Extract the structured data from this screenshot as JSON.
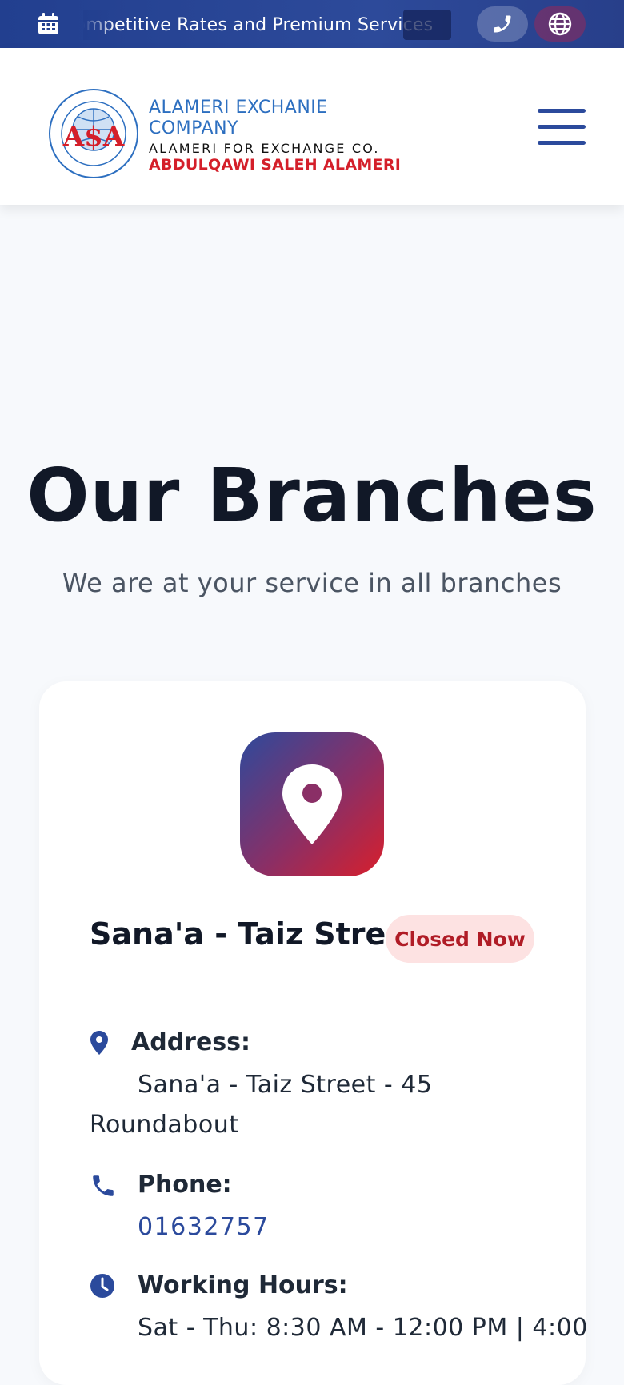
{
  "topbar": {
    "ticker_text": "Competitive Rates and Premium Services",
    "icons": [
      "calendar-icon",
      "phone-icon",
      "globe-icon"
    ]
  },
  "header": {
    "brand_line_1": "ALAMERI  EXCHANIE",
    "brand_line_2": "COMPANY",
    "brand_sub": "ALAMERI FOR EXCHANGE CO.",
    "brand_owner": "ABDULQAWI SALEH ALAMERI",
    "logo_letters": "A$A",
    "menu_icon": "hamburger-icon"
  },
  "hero": {
    "title": "Our Branches",
    "subtitle": "We are at your service in all branches"
  },
  "branch": {
    "name": "Sana'a - Taiz Street",
    "status": "Closed Now",
    "address_label": "Address:",
    "address_value": "Sana'a - Taiz Street - 45 Roundabout",
    "phone_label": "Phone:",
    "phone_value": "01632757",
    "hours_label": "Working Hours:",
    "hours_value": "Sat - Thu: 8:30 AM - 12:00 PM | 4:00"
  },
  "colors": {
    "primary": "#2b4a9c",
    "accent_red": "#d81f2c",
    "closed_badge_bg": "#fde2e2",
    "closed_badge_text": "#b01c26"
  }
}
